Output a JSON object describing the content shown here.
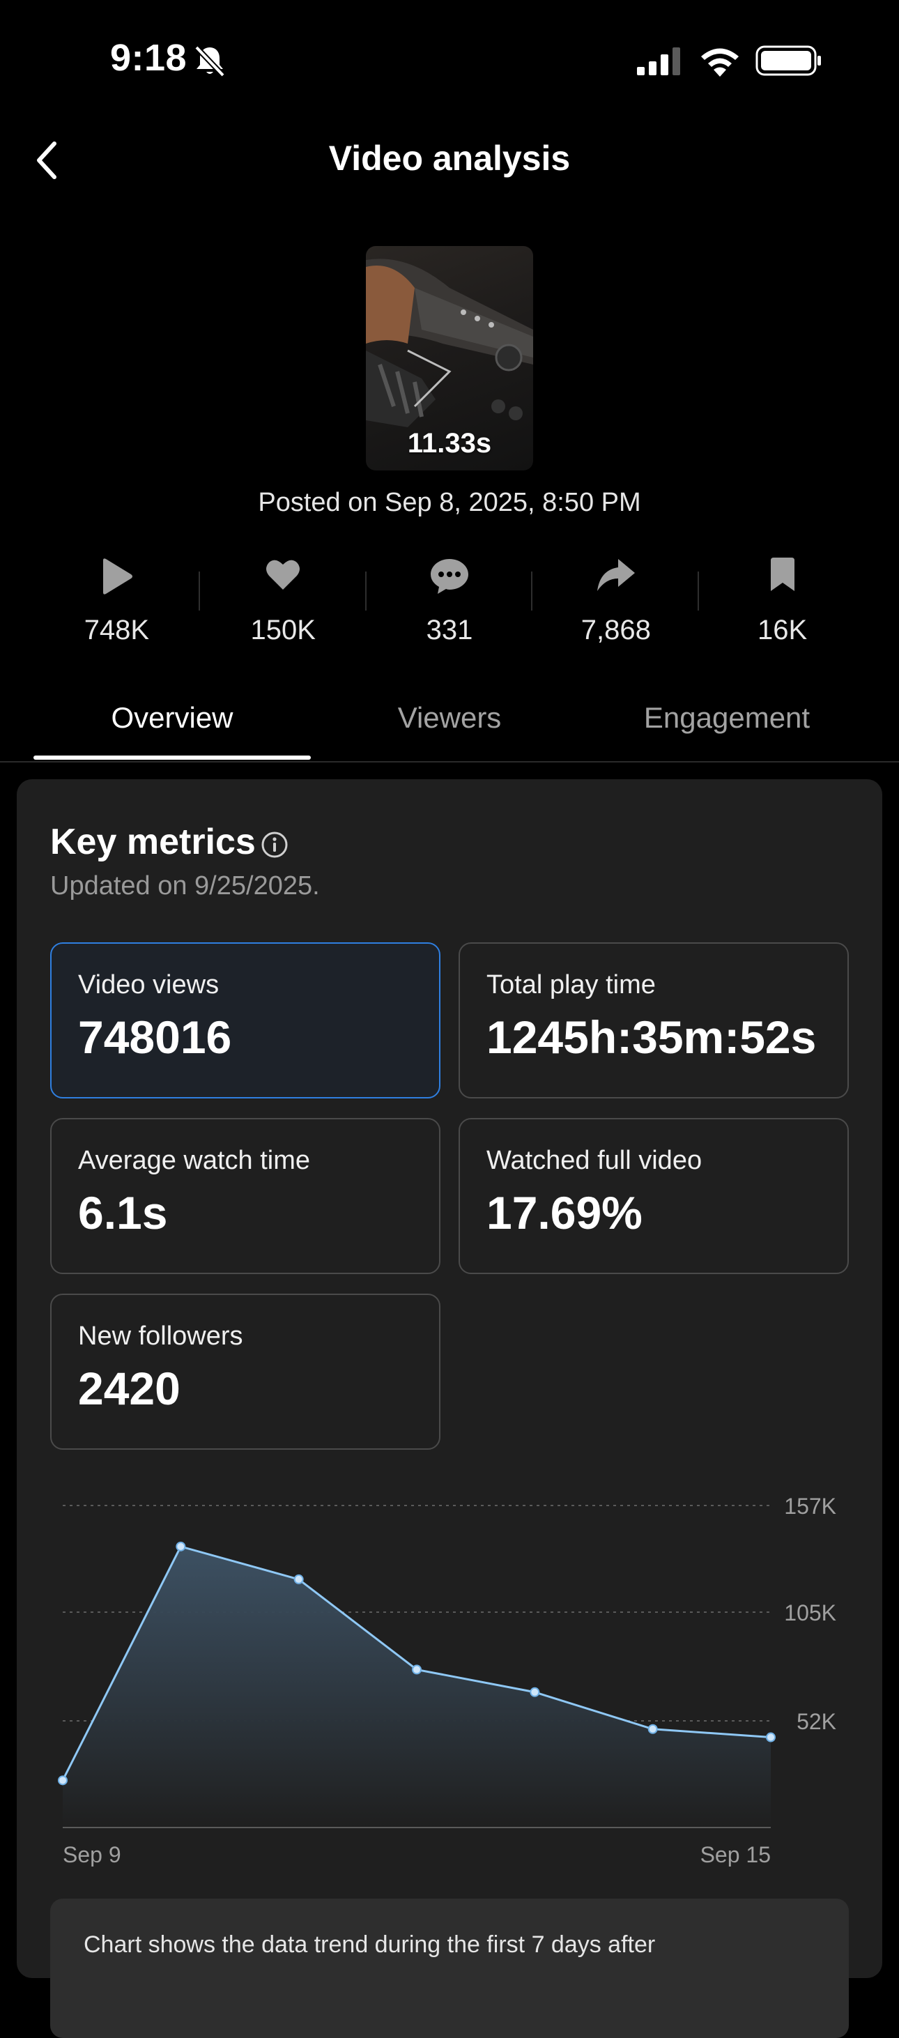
{
  "status_bar": {
    "time": "9:18",
    "icons": [
      "bell-slash-icon",
      "cellular-signal-icon",
      "wifi-icon",
      "battery-icon"
    ]
  },
  "nav": {
    "title": "Video analysis",
    "back_icon": "chevron-left-icon"
  },
  "video": {
    "duration": "11.33s",
    "posted": "Posted on Sep 8, 2025, 8:50 PM"
  },
  "stats": [
    {
      "icon": "play-icon",
      "value": "748K"
    },
    {
      "icon": "heart-icon",
      "value": "150K"
    },
    {
      "icon": "comment-icon",
      "value": "331"
    },
    {
      "icon": "share-icon",
      "value": "7,868"
    },
    {
      "icon": "bookmark-icon",
      "value": "16K"
    }
  ],
  "tabs": [
    {
      "label": "Overview",
      "active": true
    },
    {
      "label": "Viewers",
      "active": false
    },
    {
      "label": "Engagement",
      "active": false
    }
  ],
  "key_metrics": {
    "title": "Key metrics",
    "updated": "Updated on 9/25/2025.",
    "items": [
      {
        "label": "Video views",
        "value": "748016",
        "selected": true
      },
      {
        "label": "Total play time",
        "value": "1245h:35m:52s",
        "selected": false
      },
      {
        "label": "Average watch time",
        "value": "6.1s",
        "selected": false
      },
      {
        "label": "Watched full video",
        "value": "17.69%",
        "selected": false
      },
      {
        "label": "New followers",
        "value": "2420",
        "selected": false
      }
    ]
  },
  "colors": {
    "accent_blue": "#2f7fe0",
    "line": "#8fc8f5",
    "card_bg": "#1f1f1f"
  },
  "chart_data": {
    "type": "area",
    "x": [
      "Sep 9",
      "Sep 10",
      "Sep 11",
      "Sep 12",
      "Sep 13",
      "Sep 14",
      "Sep 15"
    ],
    "x_tick_labels": [
      "Sep 9",
      "Sep 15"
    ],
    "y_tick_labels": [
      "157K",
      "105K",
      "52K"
    ],
    "y_ticks": [
      157000,
      105000,
      52000
    ],
    "values": [
      23000,
      137000,
      121000,
      77000,
      66000,
      48000,
      44000
    ],
    "ylim": [
      0,
      157000
    ],
    "grid": true
  },
  "note": {
    "text": "Chart shows the data trend during the first 7 days after"
  }
}
